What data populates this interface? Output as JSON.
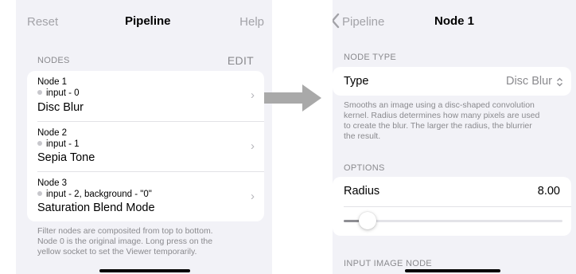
{
  "left_screen": {
    "navbar": {
      "reset_label": "Reset",
      "title": "Pipeline",
      "help_label": "Help"
    },
    "nodes_section": {
      "header": "NODES",
      "edit_label": "EDIT"
    },
    "nodes": [
      {
        "title": "Node 1",
        "input": "input - 0",
        "filter": "Disc Blur"
      },
      {
        "title": "Node 2",
        "input": "input - 1",
        "filter": "Sepia Tone"
      },
      {
        "title": "Node 3",
        "input": "input - 2, background - \"0\"",
        "filter": "Saturation Blend Mode"
      }
    ],
    "footer_lines": [
      "Filter nodes are composited from top to bottom.",
      "Node 0 is the original image. Long press on the",
      "yellow socket to set the Viewer temporarily."
    ]
  },
  "right_screen": {
    "navbar": {
      "back_label": "Pipeline",
      "title": "Node 1"
    },
    "node_type_section": {
      "header": "NODE TYPE",
      "type_label": "Type",
      "type_value": "Disc Blur"
    },
    "description_lines": [
      "Smooths an image using a disc-shaped convolution",
      "kernel. Radius determines how many pixels are used",
      "to create the blur. The larger the radius, the blurrier",
      "the result."
    ],
    "options_section": {
      "header": "OPTIONS",
      "radius_label": "Radius",
      "radius_value": "8.00",
      "radius_fraction": 0.08
    },
    "input_section": {
      "header": "INPUT IMAGE NODE"
    }
  },
  "icons": {
    "back": "chevron-left-icon",
    "row_chevron": "chevron-right-icon",
    "select": "up-down-chevron-icon",
    "transition_arrow": "arrow-right-icon",
    "socket": "socket-dot-icon"
  },
  "colors": {
    "background": "#f2f2f7",
    "secondary_text": "#8a8a8e",
    "arrow": "#a9a9a9"
  }
}
